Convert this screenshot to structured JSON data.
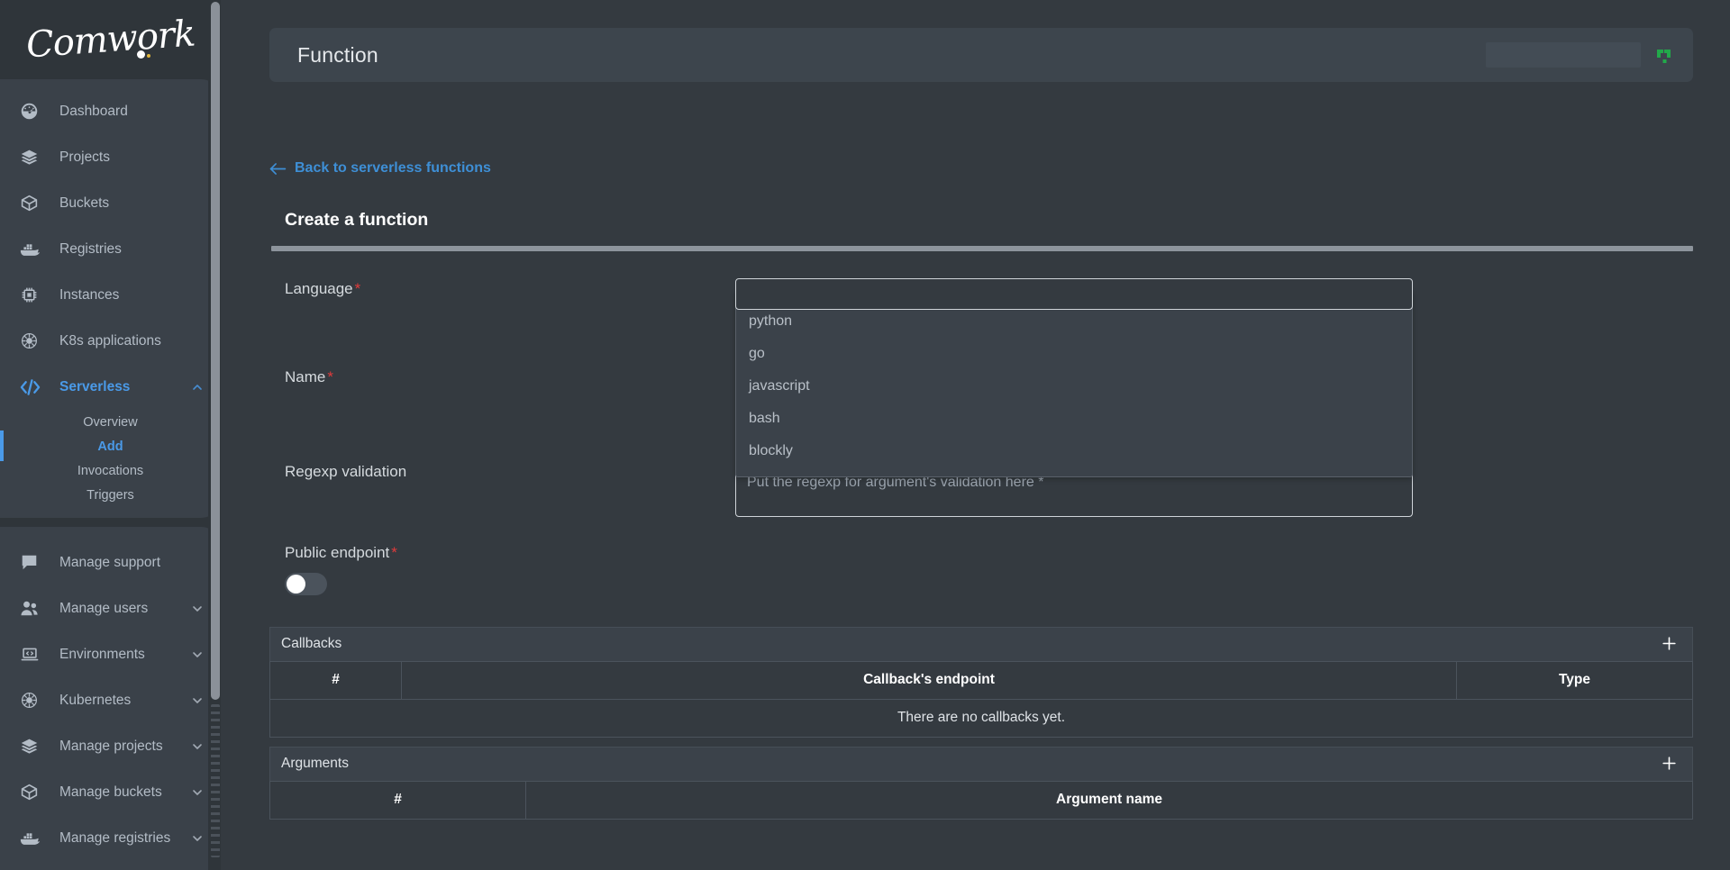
{
  "brand": {
    "name": "Comwork"
  },
  "header": {
    "title": "Function",
    "status_icon": "connection-status-icon"
  },
  "sidebar": {
    "items": [
      {
        "label": "Dashboard",
        "icon": "dashboard-gauge-icon",
        "active": false,
        "expandable": false
      },
      {
        "label": "Projects",
        "icon": "layers-icon",
        "active": false,
        "expandable": false
      },
      {
        "label": "Buckets",
        "icon": "box-icon",
        "active": false,
        "expandable": false
      },
      {
        "label": "Registries",
        "icon": "docker-whale-icon",
        "active": false,
        "expandable": false
      },
      {
        "label": "Instances",
        "icon": "cpu-chip-icon",
        "active": false,
        "expandable": false
      },
      {
        "label": "K8s applications",
        "icon": "kubernetes-helm-icon",
        "active": false,
        "expandable": false
      },
      {
        "label": "Serverless",
        "icon": "code-brackets-icon",
        "active": true,
        "expandable": true
      }
    ],
    "serverless_children": [
      {
        "label": "Overview",
        "active": false
      },
      {
        "label": "Add",
        "active": true
      },
      {
        "label": "Invocations",
        "active": false
      },
      {
        "label": "Triggers",
        "active": false
      }
    ],
    "manage_items": [
      {
        "label": "Manage support",
        "icon": "chat-bubble-icon",
        "expandable": false
      },
      {
        "label": "Manage users",
        "icon": "users-icon",
        "expandable": true
      },
      {
        "label": "Environments",
        "icon": "laptop-code-icon",
        "expandable": true
      },
      {
        "label": "Kubernetes",
        "icon": "kubernetes-helm-icon",
        "expandable": true
      },
      {
        "label": "Manage projects",
        "icon": "layers-icon",
        "expandable": true
      },
      {
        "label": "Manage buckets",
        "icon": "box-icon",
        "expandable": true
      },
      {
        "label": "Manage registries",
        "icon": "docker-whale-icon",
        "expandable": true
      }
    ]
  },
  "main": {
    "back_link": "Back to serverless functions",
    "back_icon": "arrow-left-icon",
    "page_title": "Create a function",
    "fields": {
      "language": {
        "label": "Language",
        "required_mark": "*",
        "value": ""
      },
      "name": {
        "label": "Name",
        "required_mark": "*",
        "value": ""
      },
      "regexp": {
        "label": "Regexp validation",
        "placeholder": "Put the regexp for argument's validation here *",
        "value": ""
      },
      "public_endpoint": {
        "label": "Public endpoint",
        "required_mark": "*",
        "state": "off"
      }
    },
    "language_options": [
      {
        "label": "python"
      },
      {
        "label": "go"
      },
      {
        "label": "javascript"
      },
      {
        "label": "bash"
      },
      {
        "label": "blockly"
      }
    ],
    "callbacks": {
      "title": "Callbacks",
      "add_icon": "plus-icon",
      "columns": [
        "#",
        "Callback's endpoint",
        "Type"
      ],
      "empty_text": "There are no callbacks yet.",
      "rows": []
    },
    "arguments": {
      "title": "Arguments",
      "add_icon": "plus-icon",
      "columns": [
        "#",
        "Argument name"
      ],
      "rows": []
    }
  },
  "colors": {
    "accent": "#4a9ae8",
    "link": "#3e8fd6",
    "required": "#e03b3b",
    "status_green": "#22a94a",
    "sidebar_bg": "#2f353a",
    "panel_bg": "#3a4149",
    "page_bg": "#343a40"
  }
}
